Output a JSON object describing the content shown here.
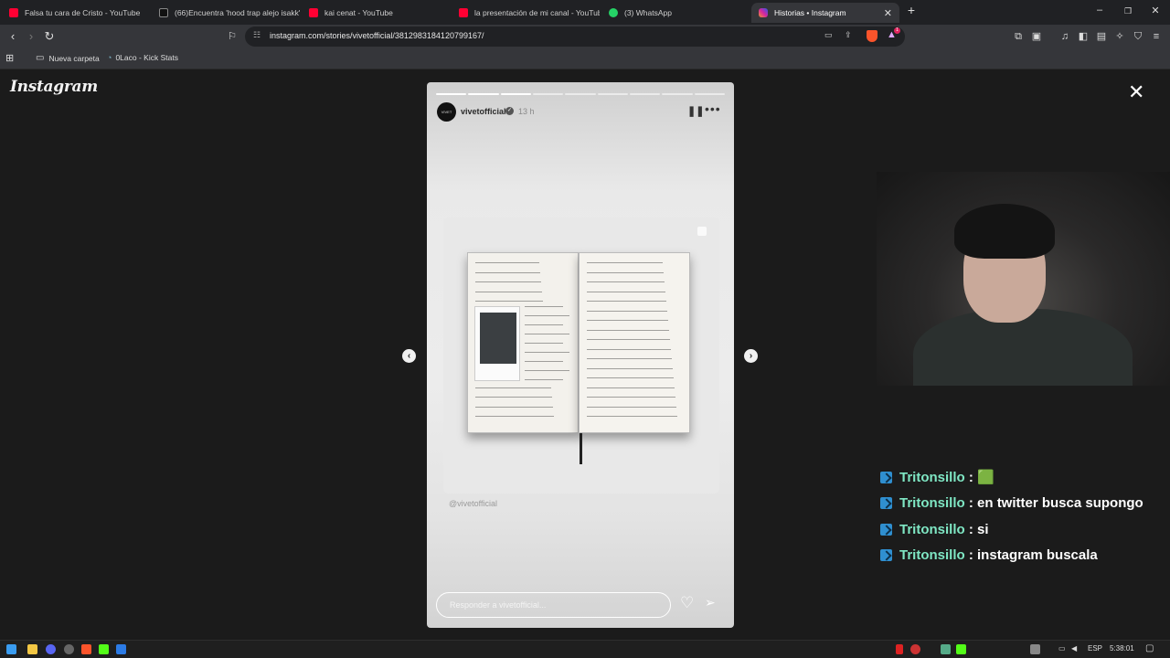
{
  "browser": {
    "tabs": [
      {
        "label": "Falsa tu cara de Cristo - YouTube",
        "favicon_color": "#ff0033",
        "active": false
      },
      {
        "label": "(66)Encuentra 'hood trap alejo isakk'",
        "favicon_color": "#111111",
        "active": false
      },
      {
        "label": "kai cenat - YouTube",
        "favicon_color": "#ff0033",
        "active": false
      },
      {
        "label": "la presentación de mi canal - YouTube",
        "favicon_color": "#ff0033",
        "active": false
      },
      {
        "label": "(3) WhatsApp",
        "favicon_color": "#25d366",
        "active": false
      },
      {
        "label": "Historias • Instagram",
        "favicon_color": "#d6249f",
        "active": true
      }
    ],
    "url": "instagram.com/stories/vivetofficial/3812983184120799167/",
    "bookmarks": [
      {
        "label": "Nueva carpeta",
        "icon": "folder-icon"
      },
      {
        "label": "0Laco - Kick Stats",
        "icon": "link-icon"
      }
    ],
    "shield_badge_count": "1"
  },
  "instagram": {
    "logo_text": "Instagram",
    "story": {
      "username": "vivetofficial",
      "time_ago": "13 h",
      "handle_overlay": "@vivetofficial",
      "reply_placeholder": "Responder a vivetofficial...",
      "segments_total": 9,
      "segments_done": 3,
      "avatar_text": "VIVET"
    }
  },
  "stream_chat": [
    {
      "user": "Tritonsillo",
      "sep": " : ",
      "message": "🟩"
    },
    {
      "user": "Tritonsillo",
      "sep": " : ",
      "message": "en twitter busca supongo"
    },
    {
      "user": "Tritonsillo",
      "sep": " : ",
      "message": "si"
    },
    {
      "user": "Tritonsillo",
      "sep": " : ",
      "message": "instagram buscala"
    }
  ],
  "taskbar": {
    "language": "ESP",
    "clock": "5:38:01"
  }
}
